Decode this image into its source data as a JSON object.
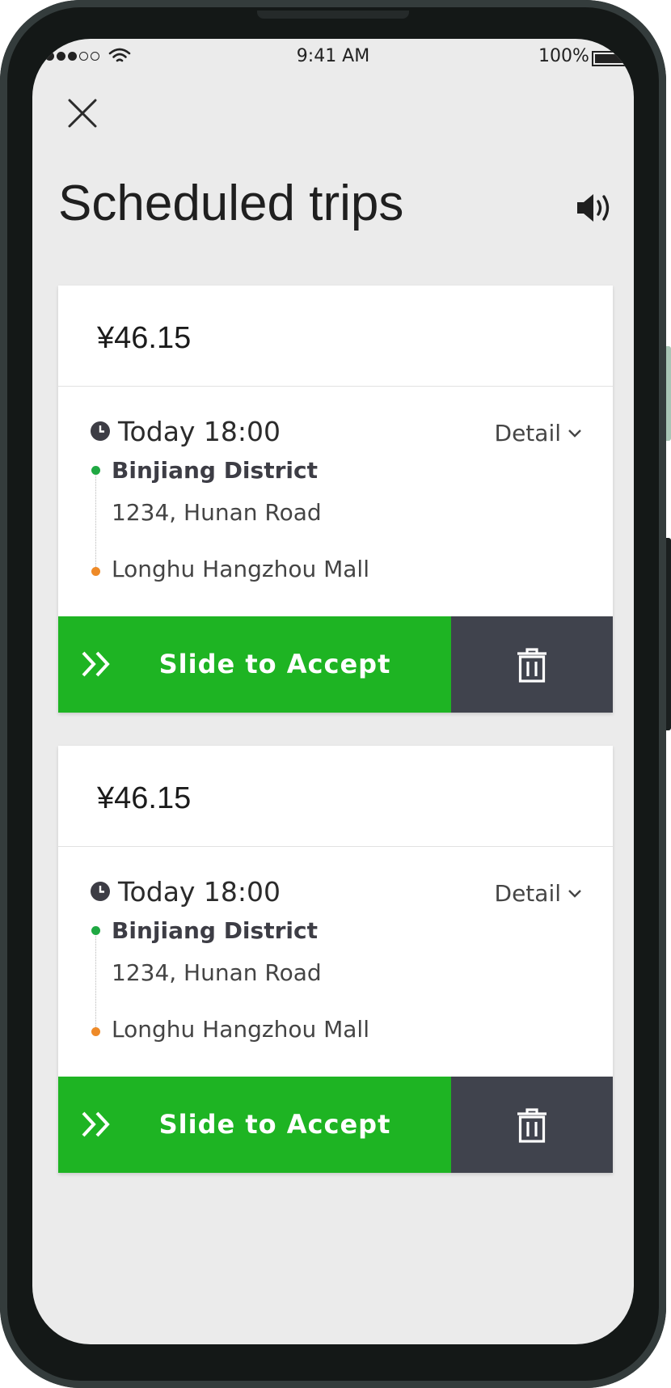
{
  "status_bar": {
    "time": "9:41 AM",
    "battery": "100%"
  },
  "header": {
    "title": "Scheduled trips"
  },
  "icons": {
    "close": "close-icon",
    "sound": "speaker-icon",
    "clock": "clock-icon",
    "chevron": "chevron-down-icon",
    "accept": "double-chevron-right-icon",
    "delete": "trash-icon"
  },
  "colors": {
    "accept": "#1eb423",
    "delete": "#40434d",
    "start_dot": "#1fa842",
    "end_dot": "#ee8a28",
    "screen_bg": "#ebebeb"
  },
  "trips": [
    {
      "fare": "¥46.15",
      "time": "Today 18:00",
      "detail_label": "Detail",
      "pickup_name": "Binjiang District",
      "pickup_address": "1234, Hunan Road",
      "dropoff_name": "Longhu Hangzhou Mall",
      "accept_label": "Slide to Accept"
    },
    {
      "fare": "¥46.15",
      "time": "Today 18:00",
      "detail_label": "Detail",
      "pickup_name": "Binjiang District",
      "pickup_address": "1234, Hunan Road",
      "dropoff_name": "Longhu Hangzhou Mall",
      "accept_label": "Slide to Accept"
    }
  ]
}
